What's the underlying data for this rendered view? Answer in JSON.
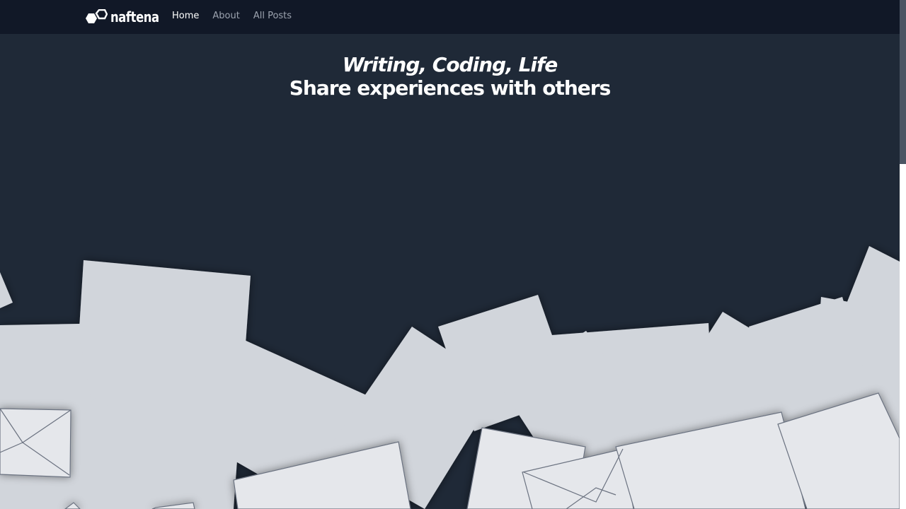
{
  "brand": {
    "name": "naftena",
    "logo_icon": "hexagon-logo-icon"
  },
  "nav": {
    "items": [
      {
        "label": "Home",
        "active": true
      },
      {
        "label": "About",
        "active": false
      },
      {
        "label": "All Posts",
        "active": false
      }
    ]
  },
  "hero": {
    "title": "Writing, Coding, Life",
    "subtitle": "Share experiences with others"
  },
  "illustration": {
    "name": "scattered-envelopes",
    "paper_color": "#d1d5db",
    "front_paper_color": "#e5e7eb"
  },
  "colors": {
    "navbar": "#111827",
    "background": "#1f2937",
    "nav_active": "#ffffff",
    "nav_inactive": "#9ca3af"
  }
}
